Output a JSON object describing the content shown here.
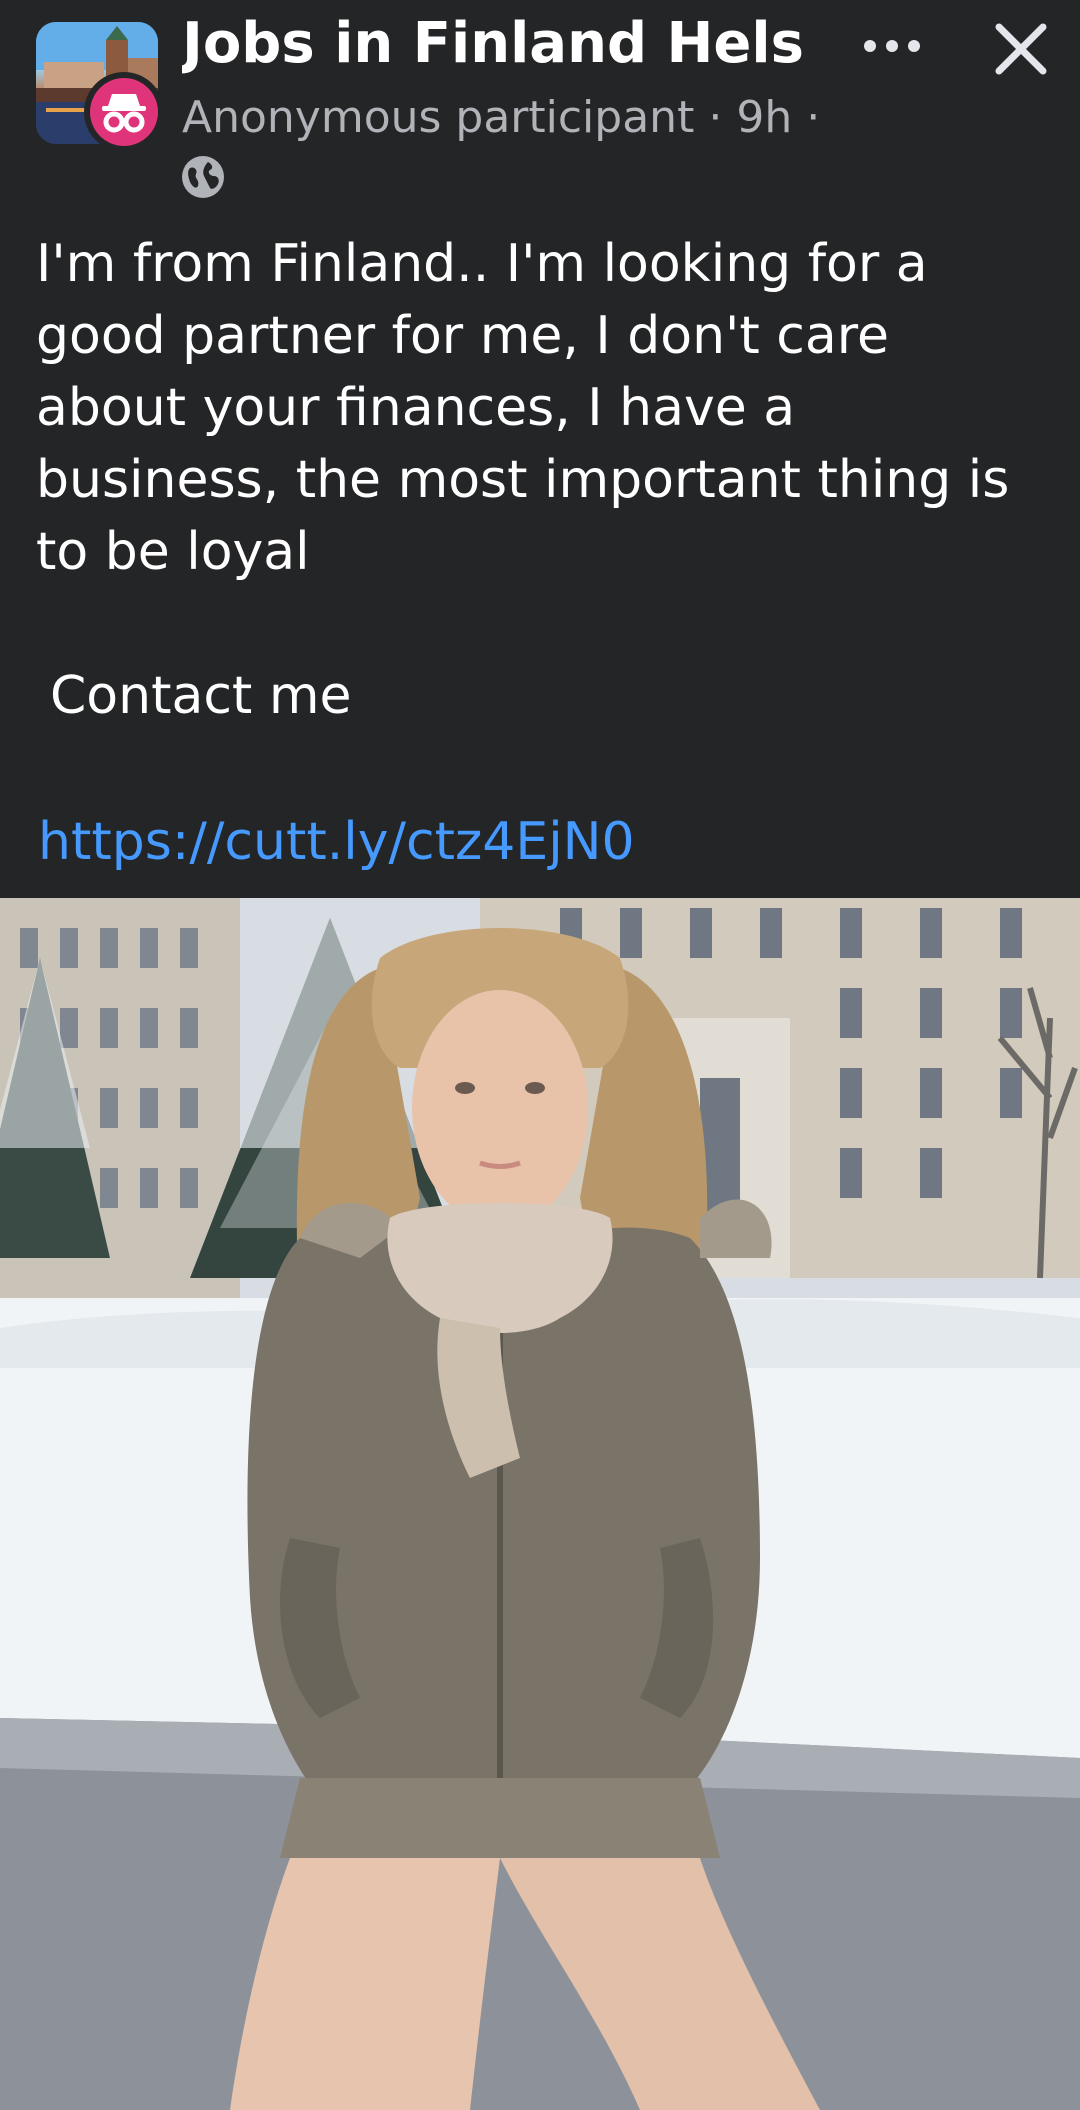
{
  "header": {
    "group_name": "Jobs in Finland Helsi...",
    "author": "Anonymous participant",
    "time": "9h",
    "separator": "·",
    "trailing_separator": "·",
    "audience_icon": "globe-icon",
    "more_icon": "more-horizontal-icon",
    "close_icon": "close-icon"
  },
  "post": {
    "text": "I'm from Finland.. I'm looking for a good partner for me, I don't care about your finances, I have a business, the most important thing is to be loyal",
    "contact": "Contact me",
    "link": "https://cutt.ly/ctz4EjN0"
  },
  "photo": {
    "subject": "woman-in-winter-parka-photo"
  },
  "colors": {
    "background": "#242526",
    "text": "#ffffff",
    "secondary_text": "#b0b3b8",
    "link": "#4599ff",
    "anonymous_badge": "#e0347a"
  }
}
